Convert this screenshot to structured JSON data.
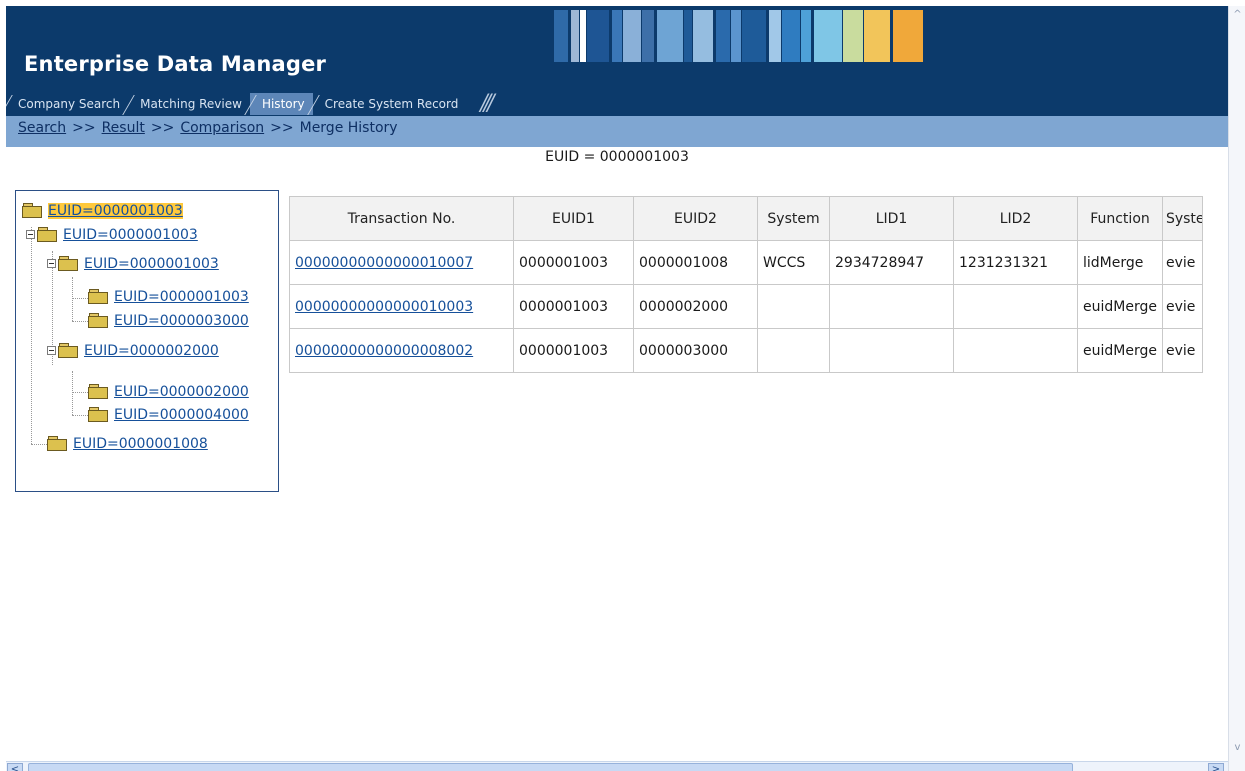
{
  "header": {
    "title": "Enterprise Data Manager",
    "strip_colors": [
      "#2f6aa8",
      "#9fb8d6",
      "#ffffff",
      "#1e5594",
      "#3a77b8",
      "#8ab0d8",
      "#3d6fa8",
      "#6ea4d4",
      "#1f5a97",
      "#95bde0",
      "#2a6aac",
      "#5b95cf",
      "#1e5b99",
      "#a1c8e8",
      "#2f7cc0",
      "#4ea1d8",
      "#7fc6e6",
      "#c9dc9e",
      "#f2c55a",
      "#f0a83a"
    ]
  },
  "tabs": [
    {
      "label": "Company Search",
      "active": false
    },
    {
      "label": "Matching Review",
      "active": false
    },
    {
      "label": "History",
      "active": true
    },
    {
      "label": "Create System Record",
      "active": false
    }
  ],
  "breadcrumb": {
    "search": "Search",
    "result": "Result",
    "comparison": "Comparison",
    "current": "Merge History",
    "separator": ">>"
  },
  "euid_caption": "EUID = 0000001003",
  "tree": [
    {
      "label": "EUID=0000001003",
      "level": 0,
      "selected": true
    },
    {
      "label": "EUID=0000001003",
      "level": 1
    },
    {
      "label": "EUID=0000001003",
      "level": 2
    },
    {
      "label": "EUID=0000001003",
      "level": 3
    },
    {
      "label": "EUID=0000003000",
      "level": 3
    },
    {
      "label": "EUID=0000002000",
      "level": 2
    },
    {
      "label": "EUID=0000002000",
      "level": 3
    },
    {
      "label": "EUID=0000004000",
      "level": 3
    },
    {
      "label": "EUID=0000001008",
      "level": 1
    }
  ],
  "table": {
    "headers": [
      "Transaction No.",
      "EUID1",
      "EUID2",
      "System",
      "LID1",
      "LID2",
      "Function",
      "System User"
    ],
    "rows": [
      [
        "00000000000000010007",
        "0000001003",
        "0000001008",
        "WCCS",
        "2934728947",
        "1231231321",
        "lidMerge",
        "evie"
      ],
      [
        "00000000000000010003",
        "0000001003",
        "0000002000",
        "",
        "",
        "",
        "euidMerge",
        "evie"
      ],
      [
        "00000000000000008002",
        "0000001003",
        "0000003000",
        "",
        "",
        "",
        "euidMerge",
        "evie"
      ]
    ]
  },
  "scroll": {
    "left": "<",
    "right": ">",
    "up": "^",
    "down": "v"
  }
}
